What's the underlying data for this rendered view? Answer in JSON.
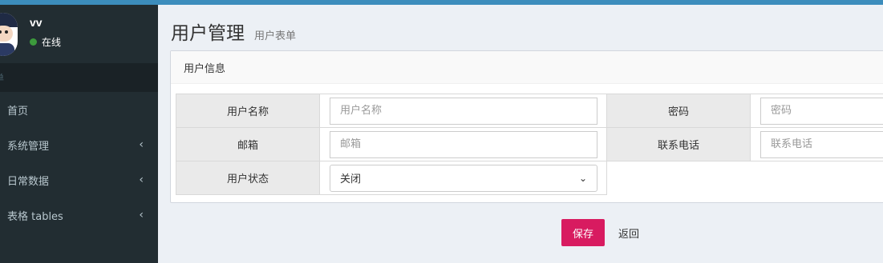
{
  "sidebar": {
    "user": {
      "name": "vv",
      "status": "在线"
    },
    "header": "单",
    "items": [
      {
        "label": "首页",
        "chevron": ""
      },
      {
        "label": "系统管理",
        "chevron": "‹"
      },
      {
        "label": "日常数据",
        "chevron": "‹"
      },
      {
        "label": "表格 tables",
        "chevron": "‹"
      }
    ]
  },
  "page": {
    "title": "用户管理",
    "subtitle": "用户表单"
  },
  "box": {
    "title": "用户信息"
  },
  "form": {
    "username_label": "用户名称",
    "username_placeholder": "用户名称",
    "password_label": "密码",
    "password_placeholder": "密码",
    "email_label": "邮箱",
    "email_placeholder": "邮箱",
    "phone_label": "联系电话",
    "phone_placeholder": "联系电话",
    "status_label": "用户状态",
    "status_value": "关闭"
  },
  "actions": {
    "save": "保存",
    "back": "返回"
  },
  "colors": {
    "topbar": "#3c8dbc",
    "sidebar": "#222d32",
    "save_button": "#d81b60",
    "online": "#3c9a3c"
  }
}
